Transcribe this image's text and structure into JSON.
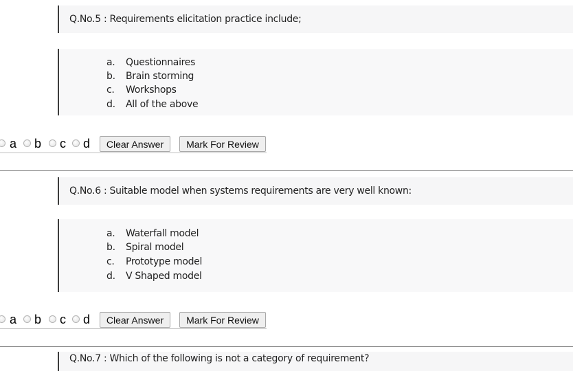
{
  "questions": [
    {
      "title": "Q.No.5 : Requirements elicitation practice include;",
      "options": [
        {
          "letter": "a.",
          "text": "Questionnaires"
        },
        {
          "letter": "b.",
          "text": "Brain storming"
        },
        {
          "letter": "c.",
          "text": "Workshops"
        },
        {
          "letter": "d.",
          "text": "All of the above"
        }
      ],
      "answers": [
        "a",
        "b",
        "c",
        "d"
      ],
      "clear_label": "Clear Answer",
      "review_label": "Mark For Review"
    },
    {
      "title": "Q.No.6 : Suitable model when systems requirements are very well known:",
      "options": [
        {
          "letter": "a.",
          "text": "Waterfall model"
        },
        {
          "letter": "b.",
          "text": "Spiral model"
        },
        {
          "letter": "c.",
          "text": "Prototype model"
        },
        {
          "letter": "d.",
          "text": "V  Shaped model"
        }
      ],
      "answers": [
        "a",
        "b",
        "c",
        "d"
      ],
      "clear_label": "Clear Answer",
      "review_label": "Mark For Review"
    },
    {
      "title": "Q.No.7 : Which of the following is not a category of requirement?"
    }
  ]
}
